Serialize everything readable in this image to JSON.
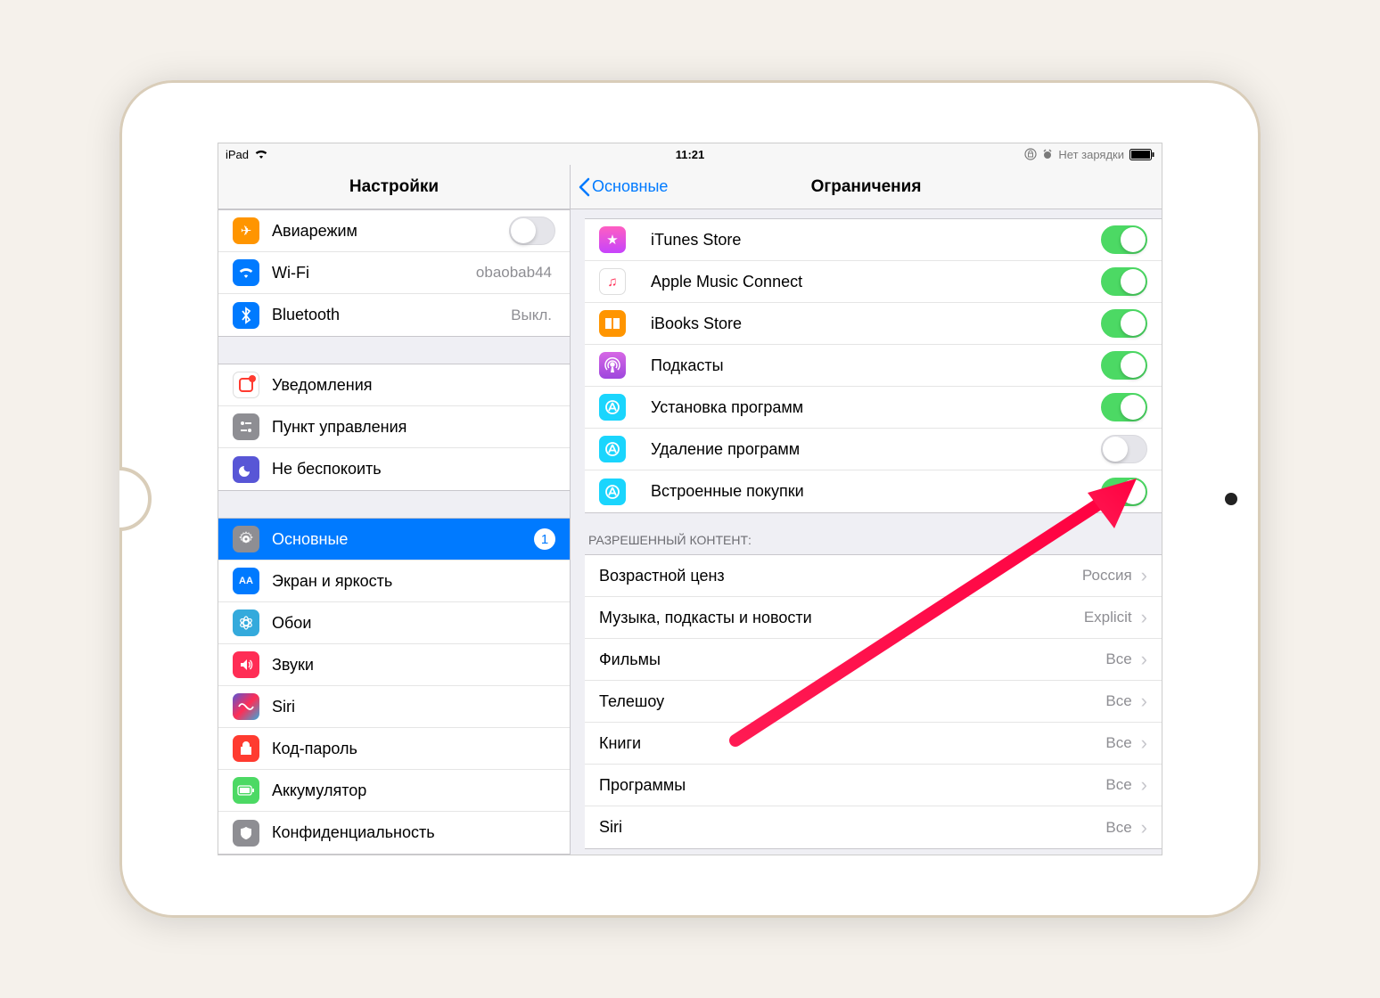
{
  "status": {
    "device": "iPad",
    "time": "11:21",
    "charging": "Нет зарядки"
  },
  "sidebar": {
    "title": "Настройки",
    "groups": [
      [
        {
          "id": "airplane",
          "label": "Авиарежим",
          "type": "toggle",
          "on": false
        },
        {
          "id": "wifi",
          "label": "Wi-Fi",
          "type": "value",
          "value": "obaobab44"
        },
        {
          "id": "bluetooth",
          "label": "Bluetooth",
          "type": "value",
          "value": "Выкл."
        }
      ],
      [
        {
          "id": "notifications",
          "label": "Уведомления",
          "type": "link"
        },
        {
          "id": "control-center",
          "label": "Пункт управления",
          "type": "link"
        },
        {
          "id": "dnd",
          "label": "Не беспокоить",
          "type": "link"
        }
      ],
      [
        {
          "id": "general",
          "label": "Основные",
          "type": "link",
          "selected": true,
          "badge": "1"
        },
        {
          "id": "display",
          "label": "Экран и яркость",
          "type": "link"
        },
        {
          "id": "wallpaper",
          "label": "Обои",
          "type": "link"
        },
        {
          "id": "sounds",
          "label": "Звуки",
          "type": "link"
        },
        {
          "id": "siri",
          "label": "Siri",
          "type": "link"
        },
        {
          "id": "passcode",
          "label": "Код-пароль",
          "type": "link"
        },
        {
          "id": "battery",
          "label": "Аккумулятор",
          "type": "link"
        },
        {
          "id": "privacy",
          "label": "Конфиденциальность",
          "type": "link"
        }
      ]
    ]
  },
  "detail": {
    "back": "Основные",
    "title": "Ограничения",
    "toggles": [
      {
        "label": "iTunes Store",
        "on": true,
        "icon": "itunes"
      },
      {
        "label": "Apple Music Connect",
        "on": true,
        "icon": "music"
      },
      {
        "label": "iBooks Store",
        "on": true,
        "icon": "ibooks"
      },
      {
        "label": "Подкасты",
        "on": true,
        "icon": "podcast"
      },
      {
        "label": "Установка программ",
        "on": true,
        "icon": "appstore"
      },
      {
        "label": "Удаление программ",
        "on": false,
        "icon": "appstore"
      },
      {
        "label": "Встроенные покупки",
        "on": true,
        "icon": "appstore"
      }
    ],
    "content_header": "РАЗРЕШЕННЫЙ КОНТЕНТ:",
    "content_rows": [
      {
        "label": "Возрастной ценз",
        "value": "Россия"
      },
      {
        "label": "Музыка, подкасты и новости",
        "value": "Explicit"
      },
      {
        "label": "Фильмы",
        "value": "Все"
      },
      {
        "label": "Телешоу",
        "value": "Все"
      },
      {
        "label": "Книги",
        "value": "Все"
      },
      {
        "label": "Программы",
        "value": "Все"
      },
      {
        "label": "Siri",
        "value": "Все"
      }
    ]
  }
}
